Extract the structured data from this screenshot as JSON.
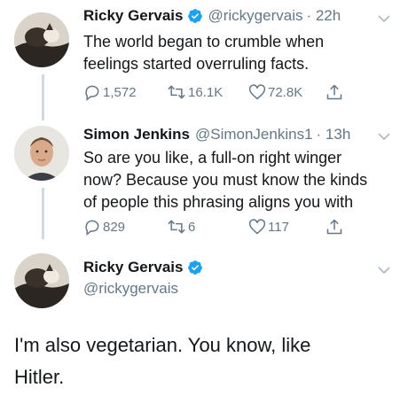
{
  "colors": {
    "verified": "#1da1f2",
    "muted": "#657786",
    "line": "#cfd9de"
  },
  "tweet1": {
    "name": "Ricky Gervais",
    "handle": "@rickygervais",
    "time": "· 22h",
    "lines": [
      "The world began to crumble when",
      "feelings started overruling facts."
    ],
    "replies": "1,572",
    "retweets": "16.1K",
    "likes": "72.8K"
  },
  "tweet2": {
    "name": "Simon Jenkins",
    "handle": "@SimonJenkins1",
    "time": "· 13h",
    "lines": [
      "So are you like, a full-on right winger",
      "now? Because you must know the kinds",
      "of people this phrasing aligns you with"
    ],
    "replies": "829",
    "retweets": "6",
    "likes": "117"
  },
  "tweet3": {
    "name": "Ricky Gervais",
    "handle": "@rickygervais",
    "lines": [
      "I'm also vegetarian. You know, like",
      "Hitler."
    ]
  },
  "icons": [
    "reply-icon",
    "retweet-icon",
    "like-icon",
    "share-icon",
    "verified-badge-icon",
    "chevron-down-icon"
  ]
}
